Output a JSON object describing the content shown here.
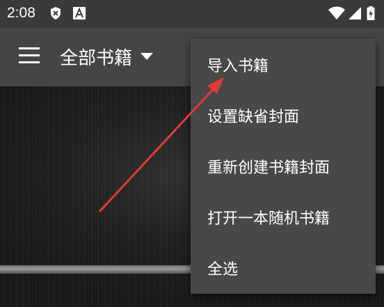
{
  "status_bar": {
    "time": "2:08",
    "left_icons": [
      "shield-x-icon",
      "a-letter-icon"
    ],
    "right_icons": [
      "wifi-icon",
      "signal-icon",
      "battery-charging-icon"
    ]
  },
  "toolbar": {
    "menu_icon": "hamburger-menu-icon",
    "title": "全部书籍",
    "dropdown_icon": "caret-down-icon"
  },
  "popup_menu": {
    "items": [
      {
        "label": "导入书籍"
      },
      {
        "label": "设置缺省封面"
      },
      {
        "label": "重新创建书籍封面"
      },
      {
        "label": "打开一本随机书籍"
      },
      {
        "label": "全选"
      }
    ]
  },
  "annotation": {
    "arrow_color": "#e53935",
    "points_to": "导入书籍"
  },
  "colors": {
    "status_bar_bg": "#3a3a3a",
    "toolbar_bg": "#454545",
    "popup_bg": "#484848",
    "text": "#ffffff"
  }
}
